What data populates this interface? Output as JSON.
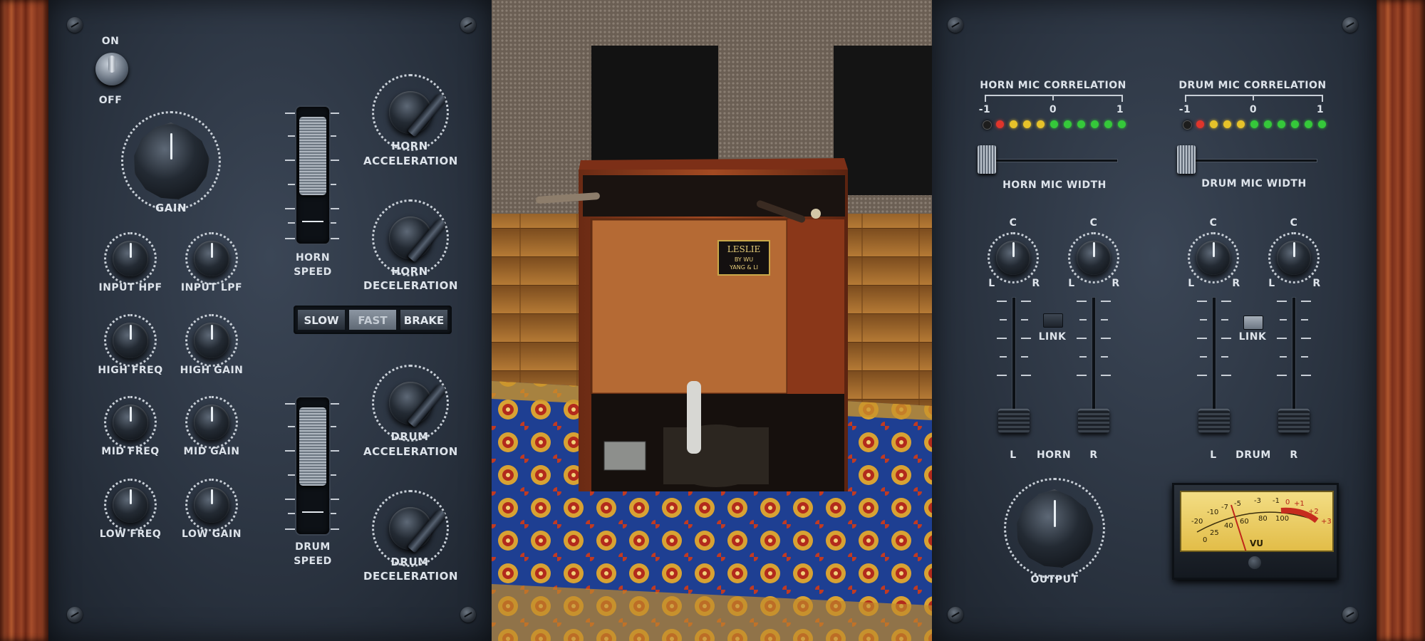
{
  "left_panel": {
    "power": {
      "on_label": "ON",
      "off_label": "OFF"
    },
    "gain_label": "GAIN",
    "eq_knobs": [
      {
        "label": "INPUT  HPF"
      },
      {
        "label": "INPUT  LPF"
      },
      {
        "label": "HIGH FREQ"
      },
      {
        "label": "HIGH GAIN"
      },
      {
        "label": "MID  FREQ"
      },
      {
        "label": "MID  GAIN"
      },
      {
        "label": "LOW  FREQ"
      },
      {
        "label": "LOW  GAIN"
      }
    ],
    "horn_speed_label_1": "HORN",
    "horn_speed_label_2": "SPEED",
    "drum_speed_label_1": "DRUM",
    "drum_speed_label_2": "SPEED",
    "horn_accel_1": "HORN",
    "horn_accel_2": "ACCELERATION",
    "horn_decel_1": "HORN",
    "horn_decel_2": "DECELERATION",
    "drum_accel_1": "DRUM",
    "drum_accel_2": "ACCELERATION",
    "drum_decel_1": "DRUM",
    "drum_decel_2": "DECELERATION",
    "speed_buttons": {
      "slow": "SLOW",
      "fast": "FAST",
      "brake": "BRAKE",
      "selected": "FAST"
    }
  },
  "cabinet": {
    "badge_line1": "LESLIE",
    "badge_line2": "BY WU",
    "badge_line3": "YANG & LI"
  },
  "right_panel": {
    "horn_corr_title": "HORN  MIC  CORRELATION",
    "drum_corr_title": "DRUM  MIC  CORRELATION",
    "corr_scale": {
      "min": "-1",
      "mid": "0",
      "max": "1"
    },
    "horn_width_label": "HORN  MIC  WIDTH",
    "drum_width_label": "DRUM  MIC  WIDTH",
    "pan_c": "C",
    "pan_l": "L",
    "pan_r": "R",
    "link_label": "LINK",
    "horn_group": "HORN",
    "drum_group": "DRUM",
    "fader_l": "L",
    "fader_r": "R",
    "output_label": "OUTPUT",
    "vu": {
      "label": "VU",
      "scale": [
        "-20",
        "-10",
        "-7",
        "-5",
        "-3",
        "-1",
        "0",
        "+1",
        "+2",
        "+3"
      ],
      "pct": [
        "0",
        "25",
        "40",
        "60",
        "80",
        "100"
      ]
    }
  },
  "colors": {
    "led_red": "#e0352b",
    "led_yellow": "#e6c22a",
    "led_green": "#35c83a",
    "led_off": "#2a2a2a"
  }
}
